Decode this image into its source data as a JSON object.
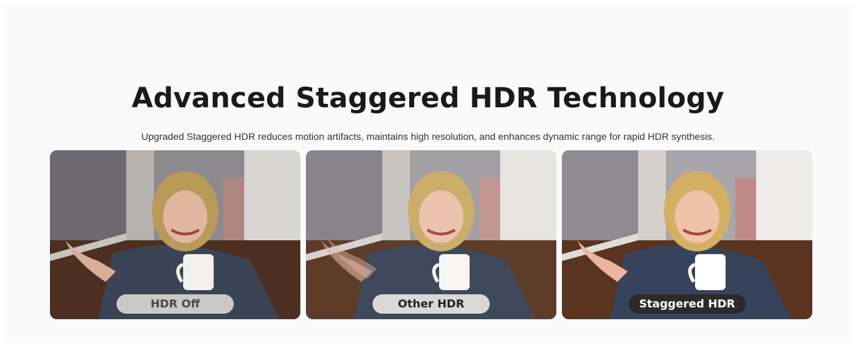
{
  "section": {
    "title": "Advanced Staggered HDR Technology",
    "subtitle": "Upgraded Staggered HDR reduces motion artifacts, maintains high resolution, and enhances dynamic range for rapid HDR synthesis."
  },
  "comparison": [
    {
      "label": "HDR Off",
      "image": "woman-with-coffee-mug-underexposed"
    },
    {
      "label": "Other HDR",
      "image": "woman-with-coffee-mug-motion-blur"
    },
    {
      "label": "Staggered HDR",
      "image": "woman-with-coffee-mug-balanced"
    }
  ]
}
